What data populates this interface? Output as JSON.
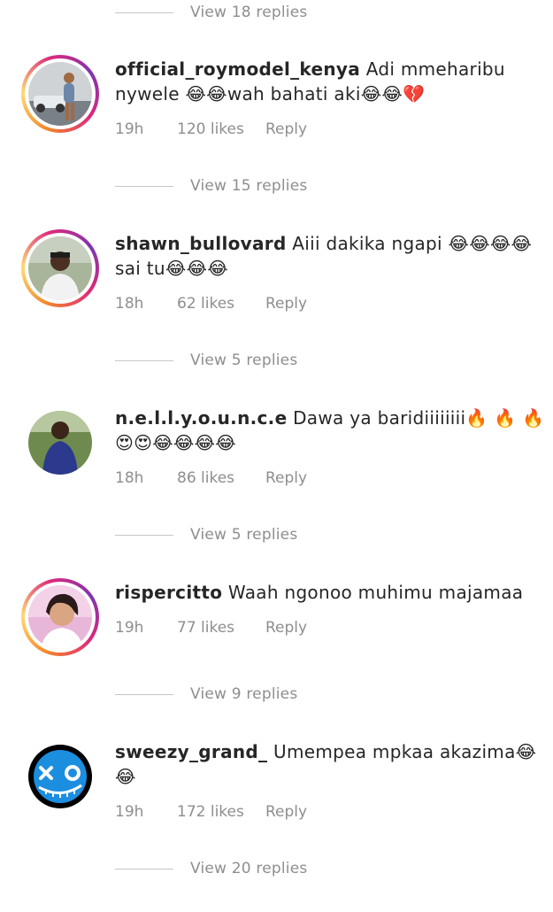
{
  "top_view_replies": "View 18 replies",
  "comments": [
    {
      "username": "official_roymodel_kenya",
      "text": "Adi mmeharibu nywele 😂😂wah bahati aki😂😂💔",
      "time": "19h",
      "likes": "120 likes",
      "reply": "Reply",
      "view_replies": "View 15 replies",
      "avatar_icon": "profile-photo-person-car",
      "has_story": true
    },
    {
      "username": "shawn_bullovard",
      "text": "Aiii dakika ngapi 😂😂😂😂 sai tu😂😂😂",
      "time": "18h",
      "likes": "62 likes",
      "reply": "Reply",
      "view_replies": "View 5 replies",
      "avatar_icon": "profile-photo-person",
      "has_story": true
    },
    {
      "username": "n.e.l.l.y.o.u.n.c.e",
      "text": "Dawa ya baridiiiiiiii🔥 🔥 🔥😍😍😂😂😂😂",
      "time": "18h",
      "likes": "86 likes",
      "reply": "Reply",
      "view_replies": "View 5 replies",
      "avatar_icon": "profile-photo-person-outdoors",
      "has_story": false
    },
    {
      "username": "rispercitto",
      "text": "Waah ngonoo muhimu majamaa",
      "time": "19h",
      "likes": "77 likes",
      "reply": "Reply",
      "view_replies": "View 9 replies",
      "avatar_icon": "profile-photo-selfie",
      "has_story": true
    },
    {
      "username": "sweezy_grand_",
      "text": "Umempea mpkaa akazima😂😂",
      "time": "19h",
      "likes": "172 likes",
      "reply": "Reply",
      "view_replies": "View 20 replies",
      "avatar_icon": "profile-graphic-xo-smile",
      "has_story": false
    }
  ]
}
